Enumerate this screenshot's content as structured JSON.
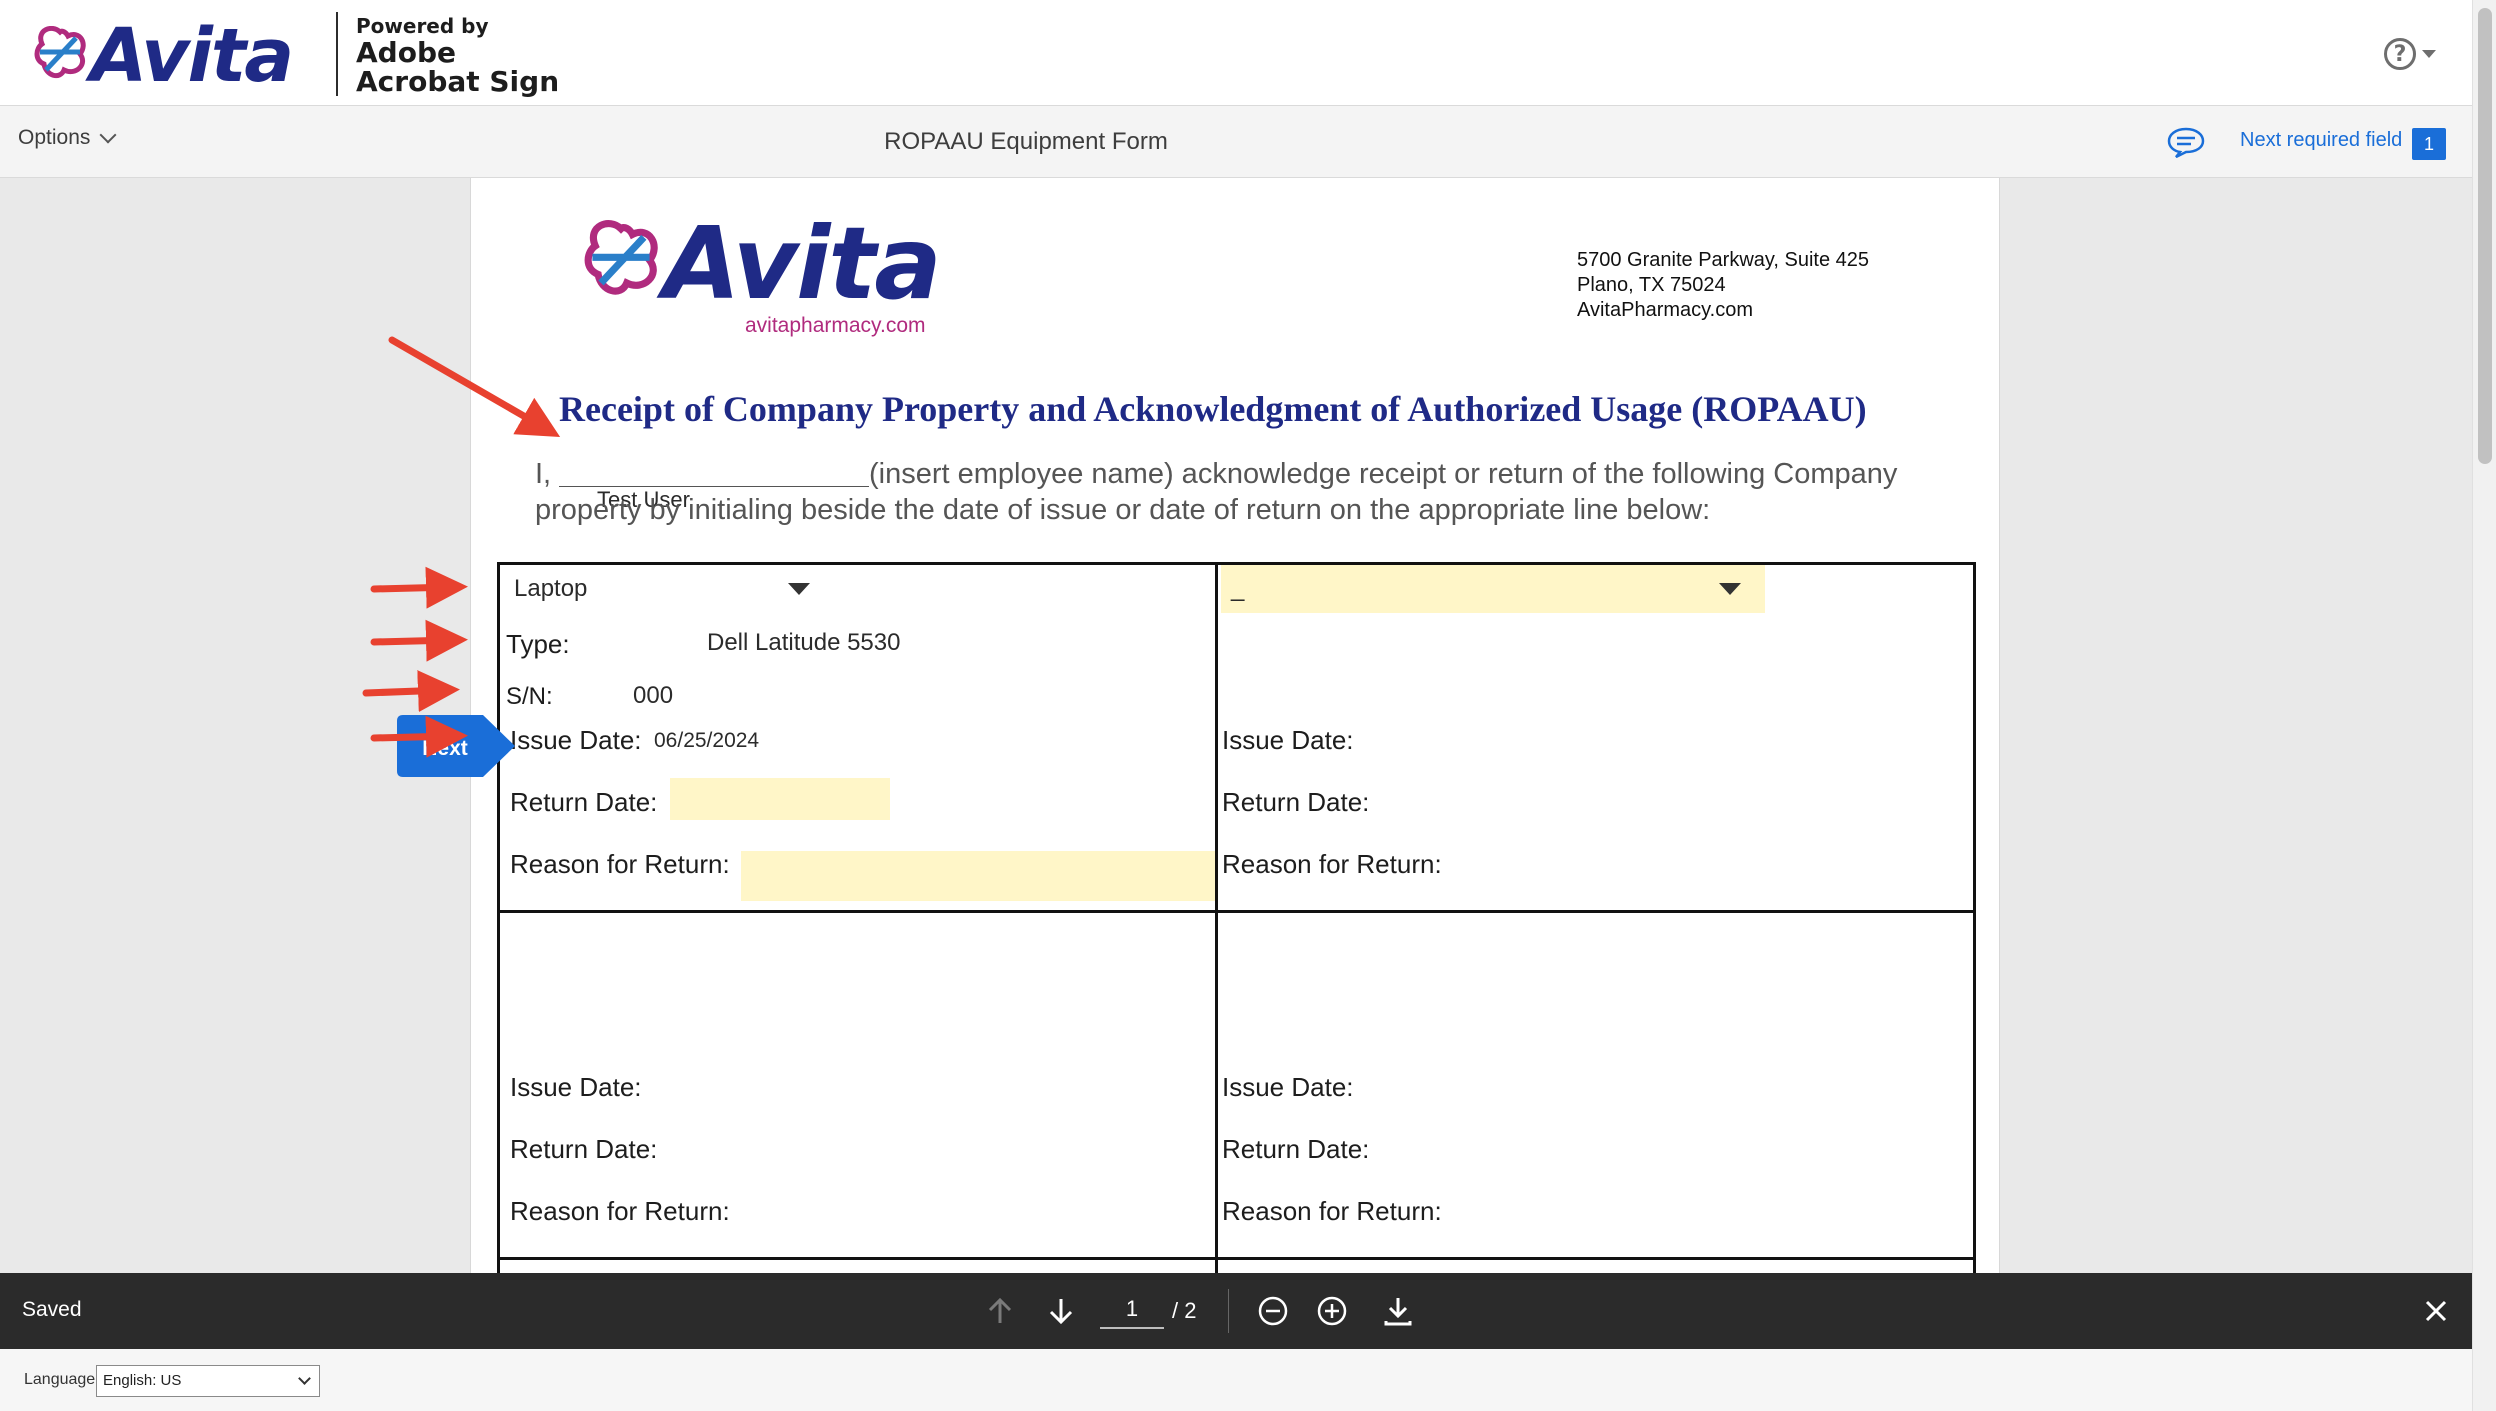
{
  "brand": {
    "logo_text": "Avita",
    "powered_by": "Powered by",
    "product_line1": "Adobe",
    "product_line2": "Acrobat Sign"
  },
  "toolbar": {
    "options_label": "Options",
    "document_title": "ROPAAU Equipment Form",
    "next_required_label": "Next required field",
    "next_required_count": "1"
  },
  "document": {
    "logo_text": "Avita",
    "logo_url": "avitapharmacy.com",
    "address": [
      "5700 Granite Parkway, Suite 425",
      "Plano, TX 75024",
      "AvitaPharmacy.com"
    ],
    "heading": "Receipt of Company Property and Acknowledgment of Authorized Usage (ROPAAU)",
    "intro_prefix": "I,",
    "employee_name": "Test User",
    "intro_line1": "(insert employee name) acknowledge receipt or return of the following Company",
    "intro_line2": "property by initialing beside the date of issue or date of return on the appropriate line below:",
    "cell1": {
      "item_dropdown": "Laptop",
      "type_label": "Type:",
      "type_value": "Dell Latitude 5530",
      "sn_label": "S/N:",
      "sn_value": "000",
      "issue_label": "Issue Date:",
      "issue_value": "06/25/2024",
      "return_label": "Return Date:",
      "reason_label": "Reason for Return:"
    },
    "cell2": {
      "item_dropdown": "_",
      "issue_label": "Issue Date:",
      "return_label": "Return Date:",
      "reason_label": "Reason for Return:"
    },
    "cell3": {
      "issue_label": "Issue Date:",
      "return_label": "Return Date:",
      "reason_label": "Reason for Return:"
    },
    "cell4": {
      "issue_label": "Issue Date:",
      "return_label": "Return Date:",
      "reason_label": "Reason for Return:"
    },
    "next_tag_label": "Next"
  },
  "bottom_bar": {
    "status": "Saved",
    "current_page": "1",
    "total_pages": "/ 2"
  },
  "language": {
    "label": "Language",
    "selected": "English: US"
  },
  "colors": {
    "brand_navy": "#1f2a86",
    "brand_magenta": "#b02b7e",
    "accent_blue": "#1a6ed8",
    "field_yellow": "#fff6c8",
    "arrow_red": "#e8412f"
  },
  "icons": [
    "help-icon",
    "chevron-down-icon",
    "comment-icon",
    "arrow-up-icon",
    "arrow-down-icon",
    "zoom-out-icon",
    "zoom-in-icon",
    "download-icon",
    "close-icon",
    "dropdown-caret-icon"
  ]
}
